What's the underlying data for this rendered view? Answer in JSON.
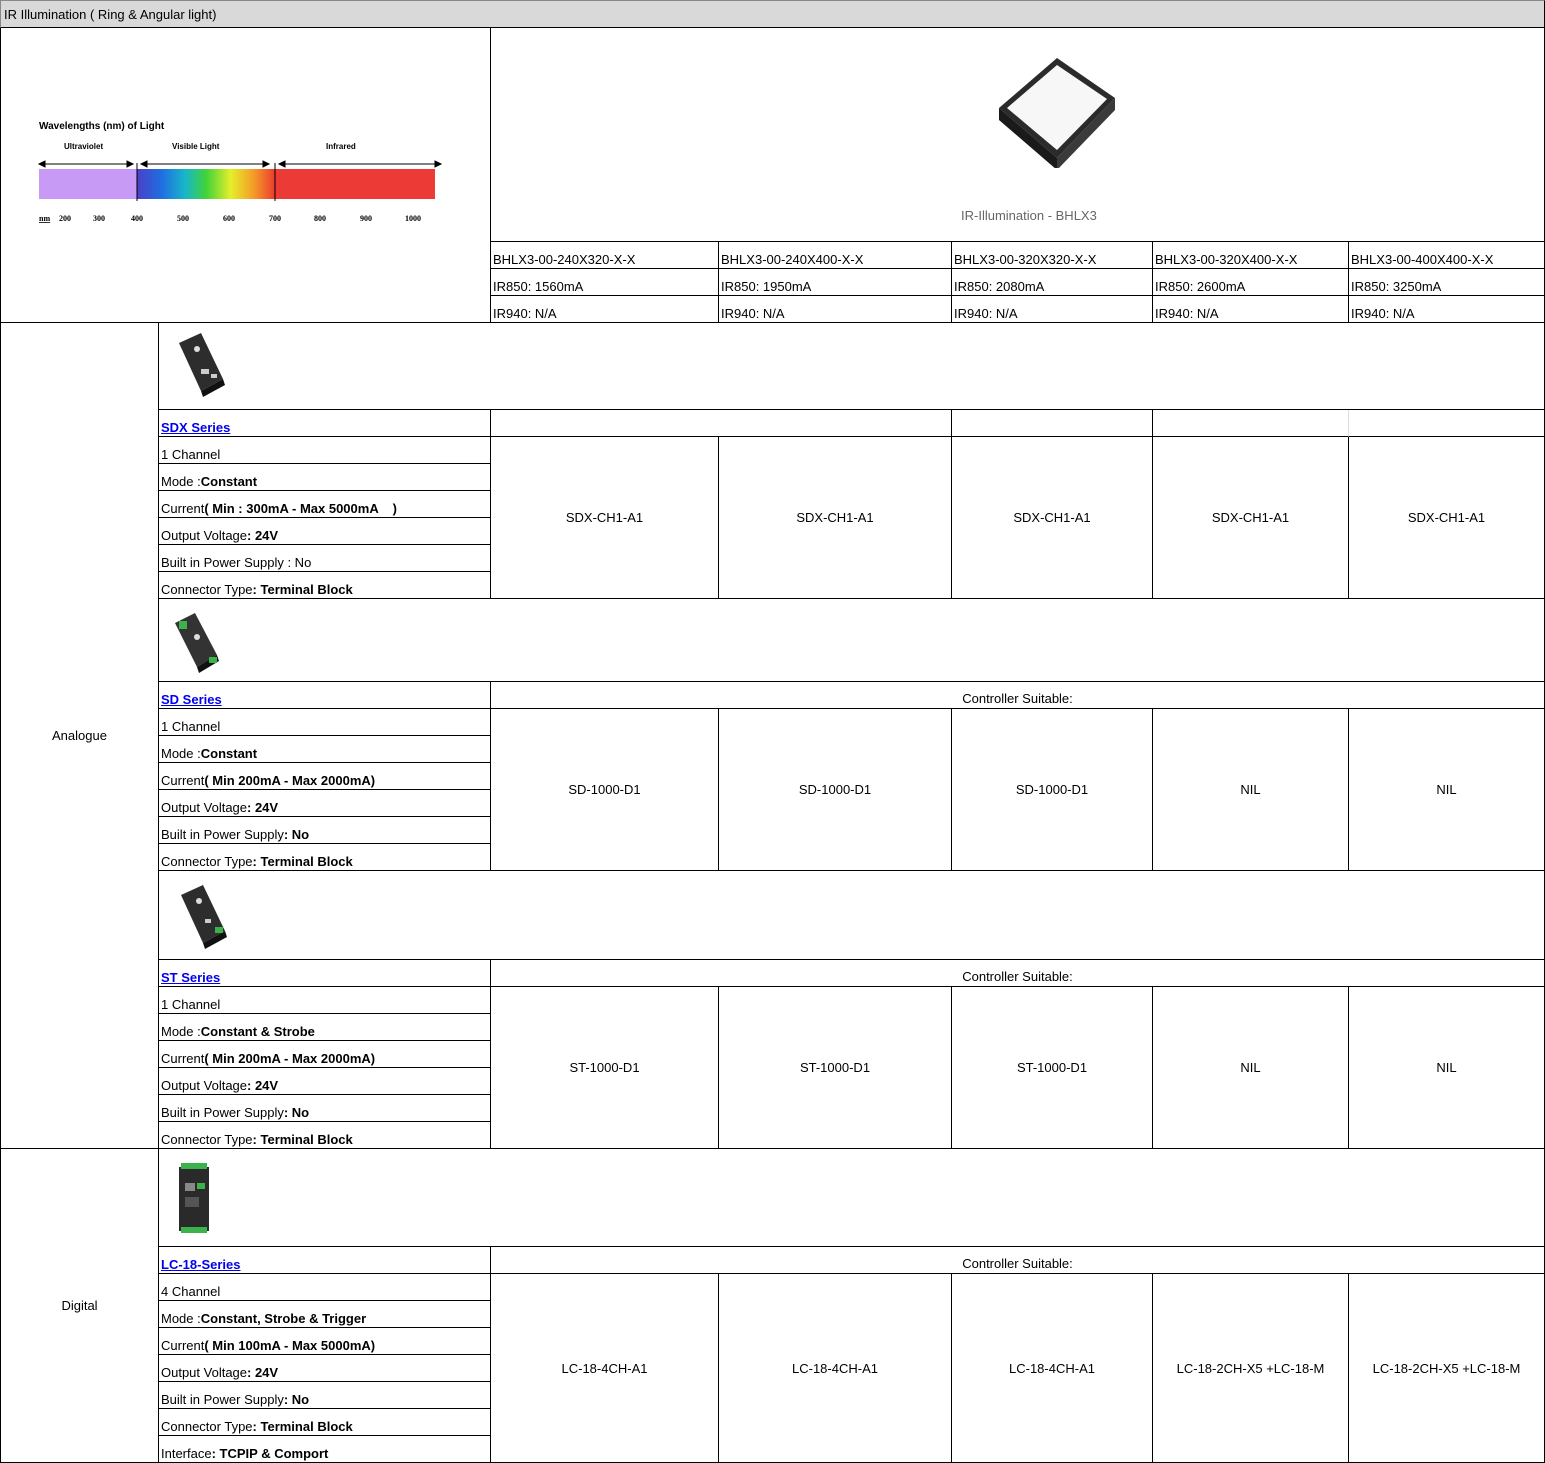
{
  "title": "IR Illumination ( Ring & Angular light)",
  "spectrum": {
    "heading": "Wavelengths (nm) of Light",
    "bands": [
      "Ultraviolet",
      "Visible Light",
      "Infrared"
    ],
    "ticks": [
      "nm",
      "200",
      "300",
      "400",
      "500",
      "600",
      "700",
      "800",
      "900",
      "1000"
    ]
  },
  "product": {
    "caption": "IR-Illumination - BHLX3",
    "models": [
      "BHLX3-00-240X320-X-X",
      "BHLX3-00-240X400-X-X",
      "BHLX3-00-320X320-X-X",
      "BHLX3-00-320X400-X-X",
      "BHLX3-00-400X400-X-X"
    ],
    "ir850": [
      "IR850: 1560mA",
      "IR850: 1950mA",
      "IR850: 2080mA",
      "IR850: 2600mA",
      "IR850: 3250mA"
    ],
    "ir940": [
      "IR940: N/A",
      "IR940: N/A",
      "IR940: N/A",
      "IR940: N/A",
      "IR940: N/A"
    ]
  },
  "groups": {
    "analogue": "Analogue",
    "digital": "Digital"
  },
  "controller_suitable": "Controller Suitable:",
  "sdx": {
    "name": "SDX Series",
    "specs": [
      {
        "k": "1  Channel",
        "v": ""
      },
      {
        "k": "Mode : ",
        "v": "Constant"
      },
      {
        "k": "Current ",
        "v": "( Min : 300mA - Max 5000mA    )"
      },
      {
        "k": "Output Voltage ",
        "v": ": 24V"
      },
      {
        "k": "Built in Power Supply : No",
        "v": ""
      },
      {
        "k": "Connector Type ",
        "v": ": Terminal Block"
      }
    ],
    "values": [
      "SDX-CH1-A1",
      "SDX-CH1-A1",
      "SDX-CH1-A1",
      "SDX-CH1-A1",
      "SDX-CH1-A1"
    ]
  },
  "sd": {
    "name": "SD Series",
    "specs": [
      {
        "k": "1  Channel",
        "v": ""
      },
      {
        "k": "Mode : ",
        "v": "Constant"
      },
      {
        "k": "Current ",
        "v": "( Min 200mA - Max 2000mA)"
      },
      {
        "k": "Output Voltage ",
        "v": ": 24V"
      },
      {
        "k": "Built in Power Supply ",
        "v": ": No"
      },
      {
        "k": "Connector Type ",
        "v": ": Terminal Block"
      }
    ],
    "values": [
      "SD-1000-D1",
      "SD-1000-D1",
      "SD-1000-D1",
      "NIL",
      "NIL"
    ]
  },
  "st": {
    "name": "ST Series",
    "specs": [
      {
        "k": "1  Channel",
        "v": ""
      },
      {
        "k": "Mode : ",
        "v": "Constant & Strobe"
      },
      {
        "k": "Current ",
        "v": "( Min 200mA - Max 2000mA)"
      },
      {
        "k": "Output Voltage ",
        "v": ": 24V"
      },
      {
        "k": "Built in Power Supply ",
        "v": ": No"
      },
      {
        "k": "Connector Type ",
        "v": ": Terminal Block"
      }
    ],
    "values": [
      "ST-1000-D1",
      "ST-1000-D1",
      "ST-1000-D1",
      "NIL",
      "NIL"
    ]
  },
  "lc": {
    "name": "LC-18-Series",
    "specs": [
      {
        "k": "4  Channel",
        "v": ""
      },
      {
        "k": "Mode : ",
        "v": "Constant, Strobe & Trigger"
      },
      {
        "k": "Current ",
        "v": "( Min 100mA - Max 5000mA)"
      },
      {
        "k": "Output Voltage ",
        "v": ": 24V"
      },
      {
        "k": "Built in Power Supply ",
        "v": ": No"
      },
      {
        "k": "Connector Type ",
        "v": ": Terminal Block"
      },
      {
        "k": "Interface ",
        "v": ": TCPIP & Comport"
      }
    ],
    "values": [
      "LC-18-4CH-A1",
      "LC-18-4CH-A1",
      "LC-18-4CH-A1",
      "LC-18-2CH-X5 +LC-18-M",
      "LC-18-2CH-X5 +LC-18-M"
    ]
  }
}
